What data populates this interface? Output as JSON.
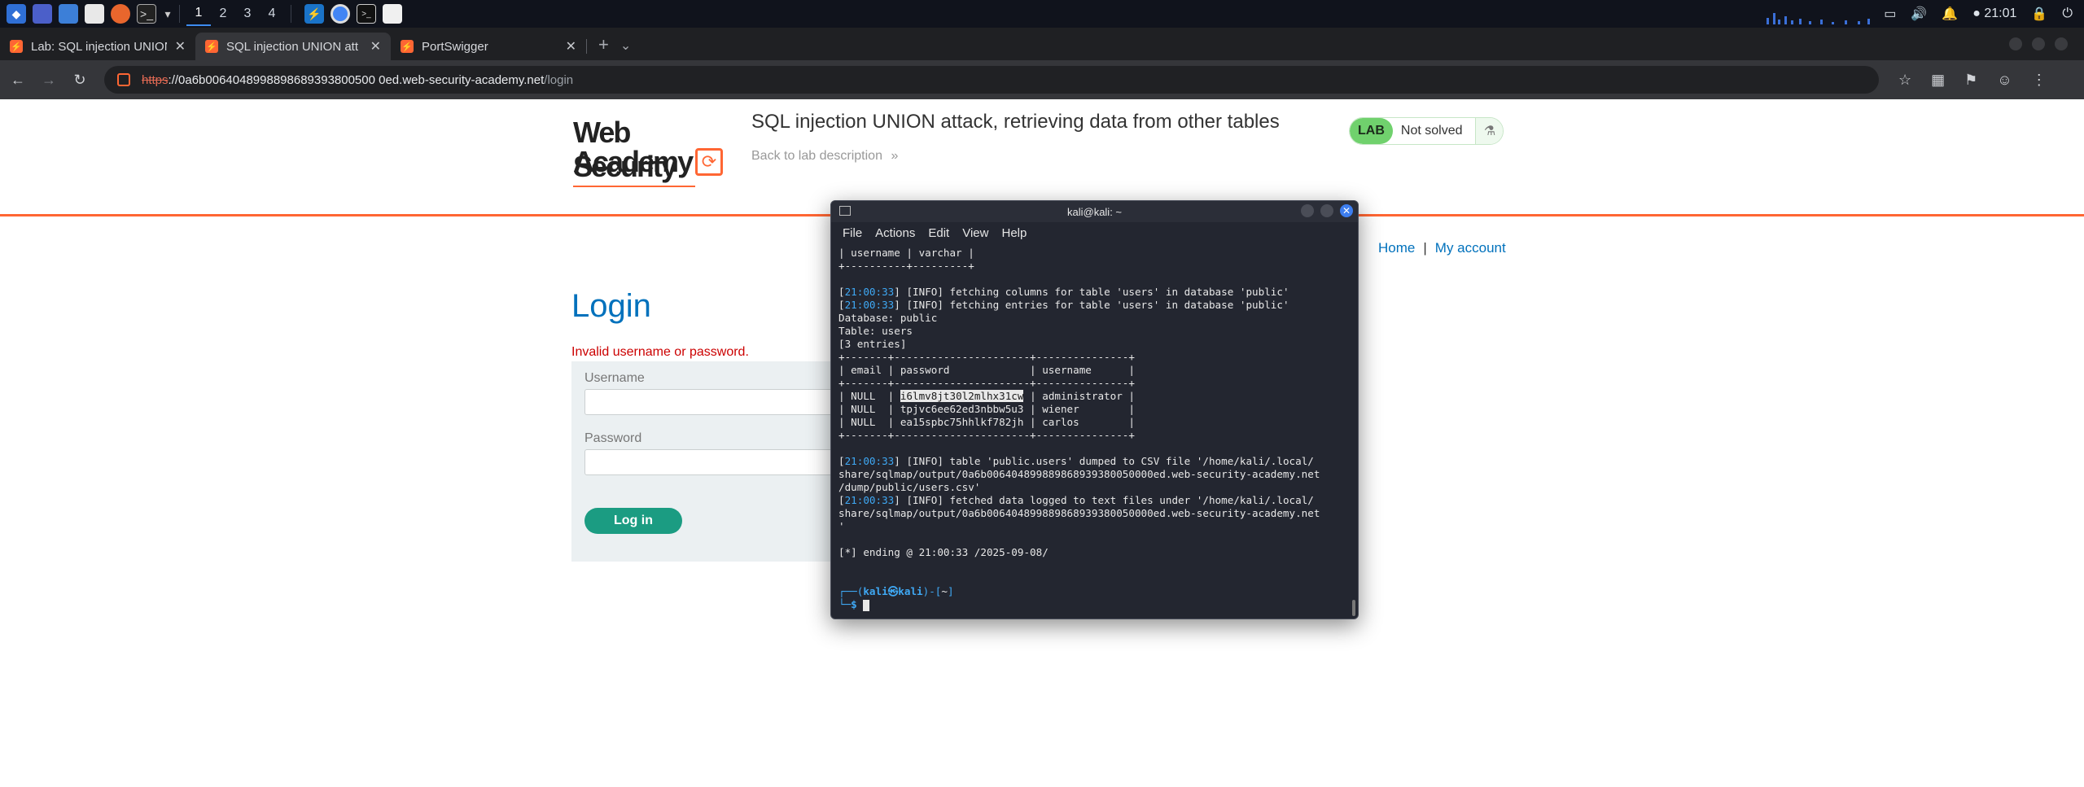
{
  "taskbar": {
    "workspaces": [
      "1",
      "2",
      "3",
      "4"
    ],
    "active_workspace": "1",
    "clock": "21:01"
  },
  "tabs": [
    {
      "title": "Lab: SQL injection UNION",
      "active": false
    },
    {
      "title": "SQL injection UNION att",
      "active": true
    },
    {
      "title": "PortSwigger",
      "active": false
    }
  ],
  "address_bar": {
    "scheme": "https",
    "host": "://0a6b0064048998898689393800500 0ed.web-security-academy.net",
    "path": "/login"
  },
  "page": {
    "logo_line1": "Web Security",
    "logo_line2": "Academy",
    "lab_title": "SQL injection UNION attack, retrieving data from other tables",
    "back_link": "Back to lab description",
    "back_link_chevron": "»",
    "lab_badge": "LAB",
    "lab_status": "Not solved",
    "nav_home": "Home",
    "nav_sep": "|",
    "nav_account": "My account",
    "login_heading": "Login",
    "error_message": "Invalid username or password.",
    "username_label": "Username",
    "password_label": "Password",
    "login_button": "Log in"
  },
  "terminal": {
    "title": "kali@kali: ~",
    "menu": [
      "File",
      "Actions",
      "Edit",
      "View",
      "Help"
    ],
    "lines": [
      {
        "text": "| username | varchar |"
      },
      {
        "text": "+----------+---------+"
      },
      {
        "text": ""
      },
      {
        "ts": "21:00:33",
        "text": " [INFO] fetching columns for table 'users' in database 'public'"
      },
      {
        "ts": "21:00:33",
        "text": " [INFO] fetching entries for table 'users' in database 'public'"
      },
      {
        "text": "Database: public"
      },
      {
        "text": "Table: users"
      },
      {
        "text": "[3 entries]"
      },
      {
        "text": "+-------+----------------------+---------------+"
      },
      {
        "text": "| email | password             | username      |"
      },
      {
        "text": "+-------+----------------------+---------------+"
      },
      {
        "pre": "| NULL  | ",
        "hl": "i6lmv8jt30l2mlhx31cw",
        "post": " | administrator |"
      },
      {
        "text": "| NULL  | tpjvc6ee62ed3nbbw5u3 | wiener        |"
      },
      {
        "text": "| NULL  | ea15spbc75hhlkf782jh | carlos        |"
      },
      {
        "text": "+-------+----------------------+---------------+"
      },
      {
        "text": ""
      },
      {
        "ts": "21:00:33",
        "text": " [INFO] table 'public.users' dumped to CSV file '/home/kali/.local/"
      },
      {
        "text": "share/sqlmap/output/0a6b006404899889868939380050000ed.web-security-academy.net"
      },
      {
        "text": "/dump/public/users.csv'"
      },
      {
        "ts": "21:00:33",
        "text": " [INFO] fetched data logged to text files under '/home/kali/.local/"
      },
      {
        "text": "share/sqlmap/output/0a6b006404899889868939380050000ed.web-security-academy.net"
      },
      {
        "text": "'"
      },
      {
        "text": ""
      },
      {
        "text": "[*] ending @ 21:00:33 /2025-09-08/"
      },
      {
        "text": ""
      },
      {
        "text": ""
      }
    ],
    "prompt_user": "kali",
    "prompt_at": "㉿",
    "prompt_host": "kali",
    "prompt_dir": "~",
    "prompt_symbol": "$"
  }
}
